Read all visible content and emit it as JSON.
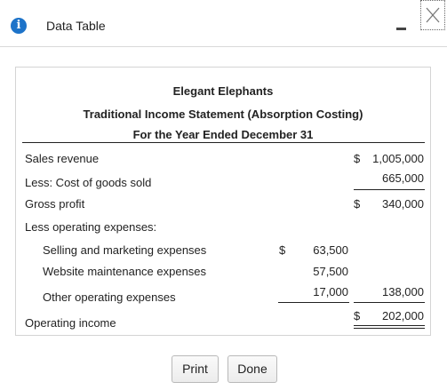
{
  "window": {
    "title": "Data Table",
    "info_icon": "info-icon",
    "minimize_icon": "minimize-icon",
    "close_icon": "close-icon",
    "accent_color": "#1d73c9"
  },
  "statement": {
    "company": "Elegant Elephants",
    "title": "Traditional Income Statement (Absorption Costing)",
    "period": "For the Year Ended December 31",
    "rows": {
      "sales_revenue": {
        "label": "Sales revenue",
        "dollar": "$",
        "amount": "1,005,000"
      },
      "cogs": {
        "label": "Less: Cost of goods sold",
        "amount": "665,000"
      },
      "gross_profit": {
        "label": "Gross profit",
        "dollar": "$",
        "amount": "340,000"
      },
      "opex_header": {
        "label": "Less operating expenses:"
      },
      "selling": {
        "label": "Selling and marketing expenses",
        "dollar": "$",
        "amount": "63,500"
      },
      "website": {
        "label": "Website maintenance expenses",
        "amount": "57,500"
      },
      "other": {
        "label": "Other operating expenses",
        "amount": "17,000",
        "total": "138,000"
      },
      "operating_income": {
        "label": "Operating income",
        "dollar": "$",
        "amount": "202,000"
      }
    }
  },
  "buttons": {
    "print": "Print",
    "done": "Done"
  }
}
